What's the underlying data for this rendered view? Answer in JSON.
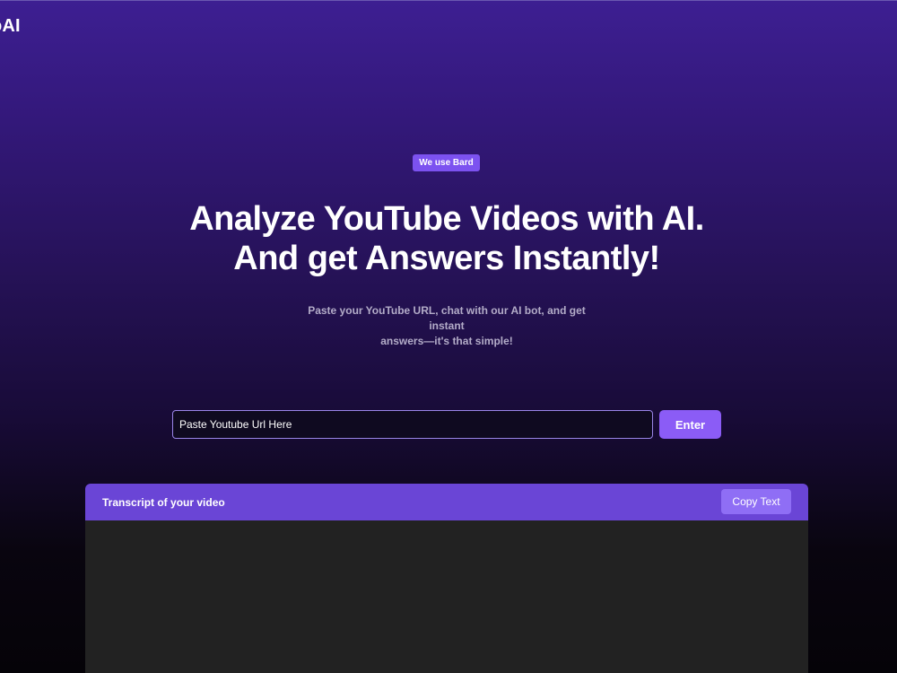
{
  "header": {
    "logo_text": "oAI"
  },
  "hero": {
    "badge": "We use Bard",
    "headline_line1": "Analyze YouTube Videos with AI.",
    "headline_line2": "And get Answers Instantly!",
    "subtitle_line1": "Paste your YouTube URL, chat with our AI bot, and get instant",
    "subtitle_line2": "answers—it's that simple!"
  },
  "url_form": {
    "placeholder": "Paste Youtube Url Here",
    "value": "",
    "submit_label": "Enter"
  },
  "transcript": {
    "title": "Transcript of your video",
    "copy_label": "Copy Text",
    "content": ""
  },
  "colors": {
    "accent": "#8b5cf6",
    "badge": "#7c52f0",
    "panel_header": "#6a45d6",
    "panel_body": "#222222",
    "gradient_top": "#3d1f92",
    "gradient_bottom": "#050308"
  }
}
